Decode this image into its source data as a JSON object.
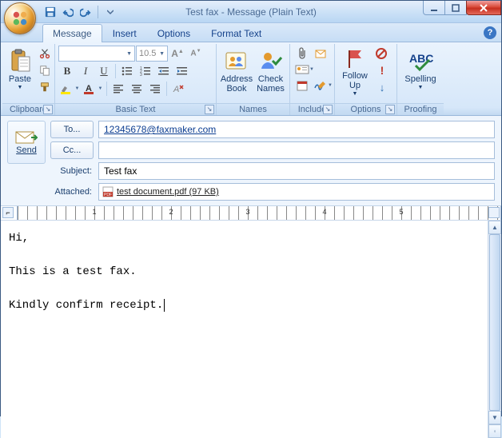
{
  "window": {
    "title": "Test fax - Message (Plain Text)"
  },
  "tabs": {
    "message": "Message",
    "insert": "Insert",
    "options": "Options",
    "format_text": "Format Text"
  },
  "ribbon": {
    "clipboard": {
      "label": "Clipboard",
      "paste": "Paste"
    },
    "basic_text": {
      "label": "Basic Text",
      "font_name_placeholder": "",
      "font_size": "10.5"
    },
    "names": {
      "label": "Names",
      "address_book": "Address\nBook",
      "check_names": "Check\nNames"
    },
    "include": {
      "label": "Include"
    },
    "options": {
      "label": "Options",
      "follow_up": "Follow\nUp"
    },
    "proofing": {
      "label": "Proofing",
      "spelling": "Spelling"
    }
  },
  "send": {
    "label": "Send"
  },
  "fields": {
    "to_btn": "To...",
    "cc_btn": "Cc...",
    "subject_label": "Subject:",
    "attached_label": "Attached:",
    "to_value": "12345678@faxmaker.com",
    "cc_value": "",
    "subject_value": "Test fax",
    "attachment_name": "test document.pdf (97 KB)"
  },
  "ruler_numbers": [
    "1",
    "2",
    "3",
    "4",
    "5"
  ],
  "body": "Hi,\n\nThis is a test fax.\n\nKindly confirm receipt."
}
